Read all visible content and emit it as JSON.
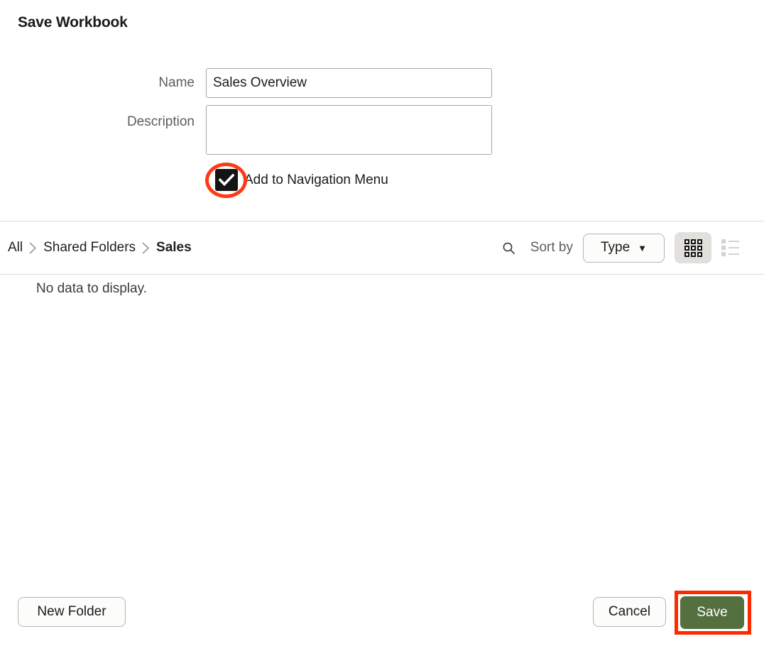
{
  "dialog": {
    "title": "Save Workbook"
  },
  "form": {
    "name": {
      "label": "Name",
      "value": "Sales Overview",
      "placeholder": ""
    },
    "description": {
      "label": "Description",
      "value": "",
      "placeholder": ""
    },
    "nav_checkbox": {
      "label": "Add to Navigation Menu",
      "checked": true
    }
  },
  "browser": {
    "breadcrumb": [
      {
        "label": "All",
        "current": false
      },
      {
        "label": "Shared Folders",
        "current": false
      },
      {
        "label": "Sales",
        "current": true
      }
    ],
    "search_icon": "search-icon",
    "sort_label": "Sort by",
    "sort_value": "Type",
    "sort_caret": "▼",
    "view_grid_icon": "grid-view-icon",
    "view_list_icon": "list-view-icon",
    "active_view": "grid",
    "empty_message": "No data to display."
  },
  "footer": {
    "new_folder_label": "New Folder",
    "cancel_label": "Cancel",
    "save_label": "Save"
  },
  "annotations": {
    "checkbox_highlight_color": "#fc3b14",
    "save_highlight_color": "#fc2a00"
  },
  "colors": {
    "save_button_green": "#55703f",
    "label_gray": "#5d5d5d",
    "divider": "#dcdcdc",
    "active_view_chip": "#e2e0dc"
  }
}
